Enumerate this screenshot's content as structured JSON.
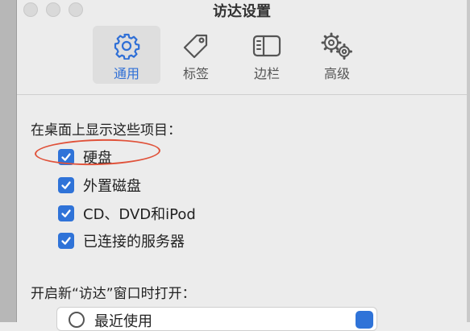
{
  "window": {
    "title": "访达设置"
  },
  "toolbar": {
    "tabs": [
      {
        "label": "通用",
        "icon": "gear-icon",
        "selected": true
      },
      {
        "label": "标签",
        "icon": "tag-icon",
        "selected": false
      },
      {
        "label": "边栏",
        "icon": "sidebar-icon",
        "selected": false
      },
      {
        "label": "高级",
        "icon": "gears-icon",
        "selected": false
      }
    ]
  },
  "desktop_section": {
    "heading": "在桌面上显示这些项目：",
    "items": [
      {
        "label": "硬盘",
        "checked": true
      },
      {
        "label": "外置磁盘",
        "checked": true
      },
      {
        "label": "CD、DVD和iPod",
        "checked": true
      },
      {
        "label": "已连接的服务器",
        "checked": true
      }
    ]
  },
  "new_window_section": {
    "heading": "开启新“访达”窗口时打开：",
    "selected": "最近使用"
  },
  "colors": {
    "accent": "#2f73d8",
    "annotation": "#e0523a"
  }
}
